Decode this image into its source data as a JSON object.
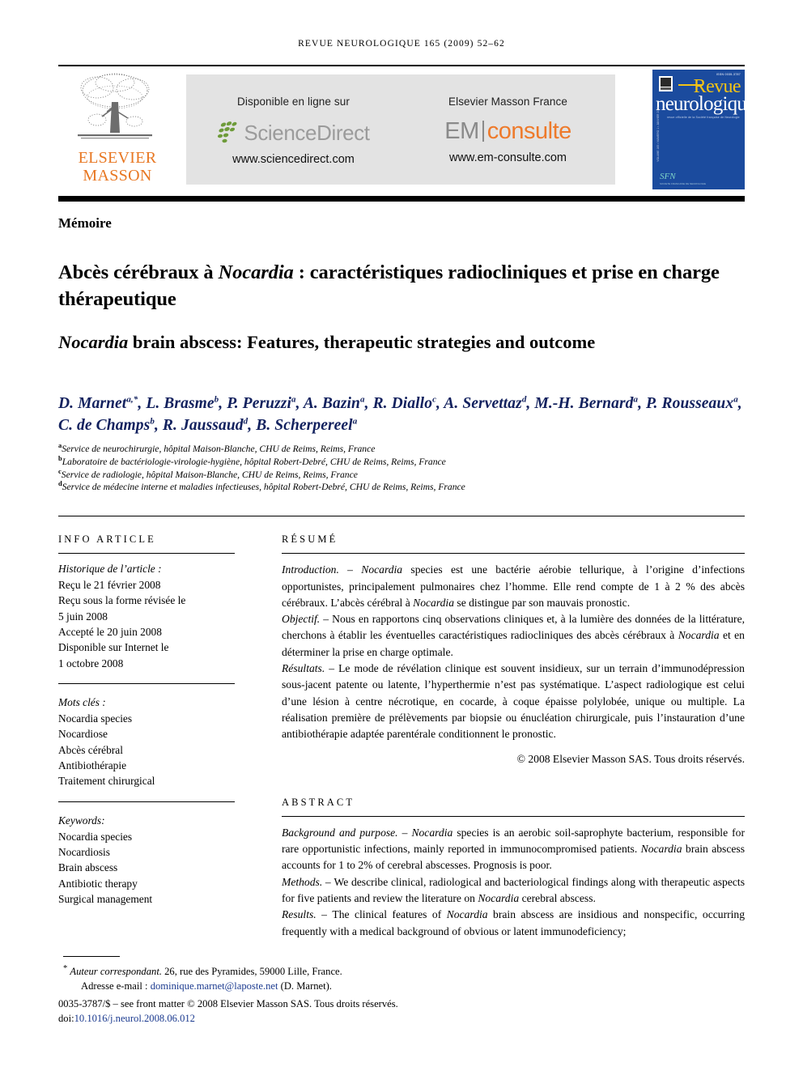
{
  "running_head": "REVUE NEUROLOGIQUE 165 (2009) 52–62",
  "banner": {
    "publisher_name_line1": "ELSEVIER",
    "publisher_name_line2": "MASSON",
    "sciencedirect": {
      "caption": "Disponible en ligne sur",
      "wordmark": "ScienceDirect",
      "url": "www.sciencedirect.com"
    },
    "emconsulte": {
      "caption": "Elsevier Masson France",
      "wordmark_em": "EM",
      "wordmark_consulte": "consulte",
      "url": "www.em-consulte.com"
    },
    "cover": {
      "title_line1": "Revue",
      "title_line2": "neurologique",
      "subline": "revue officielle de la Société française de Neurologie",
      "spine_text": "VOLUME 165 • NUMERO 1 • JANVIER 2009",
      "issn_tiny": "ISSN 0035-3787",
      "sfn_mark": "SFN",
      "sfn_sub": "SOCIETE FRANCAISE DE NEUROLOGIE"
    }
  },
  "article_type": "Mémoire",
  "title_fr": "Abcès cérébraux à Nocardia : caractéristiques radiocliniques et prise en charge thérapeutique",
  "title_fr_italic_word": "Nocardia",
  "title_en_pre": "",
  "title_en_italic_word": "Nocardia",
  "title_en_rest": " brain abscess: Features, therapeutic strategies and outcome",
  "authors": [
    {
      "name": "D. Marnet",
      "sup": "a,*"
    },
    {
      "name": "L. Brasme",
      "sup": "b"
    },
    {
      "name": "P. Peruzzi",
      "sup": "a"
    },
    {
      "name": "A. Bazin",
      "sup": "a"
    },
    {
      "name": "R. Diallo",
      "sup": "c"
    },
    {
      "name": "A. Servettaz",
      "sup": "d"
    },
    {
      "name": "M.-H. Bernard",
      "sup": "a"
    },
    {
      "name": "P. Rousseaux",
      "sup": "a"
    },
    {
      "name": "C. de Champs",
      "sup": "b"
    },
    {
      "name": "R. Jaussaud",
      "sup": "d"
    },
    {
      "name": "B. Scherpereel",
      "sup": "a"
    }
  ],
  "affiliations": [
    {
      "mark": "a",
      "text": "Service de neurochirurgie, hôpital Maison-Blanche, CHU de Reims, Reims, France"
    },
    {
      "mark": "b",
      "text": "Laboratoire de bactériologie-virologie-hygiène, hôpital Robert-Debré, CHU de Reims, Reims, France"
    },
    {
      "mark": "c",
      "text": "Service de radiologie, hôpital Maison-Blanche, CHU de Reims, Reims, France"
    },
    {
      "mark": "d",
      "text": "Service de médecine interne et maladies infectieuses, hôpital Robert-Debré, CHU de Reims, Reims, France"
    }
  ],
  "info_article": {
    "heading": "INFO ARTICLE",
    "history_label": "Historique de l’article :",
    "history_lines": [
      "Reçu le 21 février 2008",
      "Reçu sous la forme révisée le",
      "5 juin 2008",
      "Accepté le  20 juin 2008",
      "Disponible sur Internet le",
      "1 octobre 2008"
    ],
    "motscles_label": "Mots clés :",
    "motscles": [
      "Nocardia species",
      "Nocardiose",
      "Abcès cérébral",
      "Antibiothérapie",
      "Traitement chirurgical"
    ],
    "keywords_label": "Keywords:",
    "keywords": [
      "Nocardia species",
      "Nocardiosis",
      "Brain abscess",
      "Antibiotic therapy",
      "Surgical management"
    ]
  },
  "resume": {
    "heading": "RÉSUMÉ",
    "paragraphs": [
      {
        "lead": "Introduction. – ",
        "text_1": "Nocardia",
        "text_2": " species est une bactérie aérobie tellurique, à l’origine d’infections opportunistes, principalement pulmonaires chez l’homme. Elle rend compte de 1 à 2 % des abcès cérébraux. L’abcès cérébral à ",
        "text_3": "Nocardia",
        "text_4": " se distingue par son mauvais pronostic."
      },
      {
        "lead": "Objectif. – ",
        "text_1": "Nous en rapportons cinq observations cliniques et, à la lumière des données de la littérature, cherchons à établir les éventuelles caractéristiques radiocliniques des abcès cérébraux à ",
        "text_2": "Nocardia",
        "text_3": " et en déterminer la prise en charge optimale."
      },
      {
        "lead": "Résultats. – ",
        "text_1": "Le mode de révélation clinique est souvent insidieux, sur un terrain d’immunodépression sous-jacent patente ou latente, l’hyperthermie n’est pas systématique. L’aspect radiologique est celui d’une lésion à centre nécrotique, en cocarde, à coque épaisse polylobée, unique ou multiple. La réalisation première de prélèvements par biopsie ou énucléation chirurgicale, puis l’instauration d’une antibiothérapie adaptée parentérale conditionnent le pronostic."
      }
    ],
    "copyright": "© 2008 Elsevier Masson SAS. Tous droits réservés."
  },
  "abstract": {
    "heading": "ABSTRACT",
    "paragraphs": [
      {
        "lead": "Background and purpose. – ",
        "text_1": "Nocardia",
        "text_2": " species is an aerobic soil-saprophyte bacterium, responsible for rare opportunistic infections, mainly reported in immunocompromised patients. ",
        "text_3": "Nocardia",
        "text_4": " brain abscess accounts for 1 to 2% of cerebral abscesses. Prognosis is poor."
      },
      {
        "lead": "Methods. – ",
        "text_1": "We describe clinical, radiological and bacteriological findings along with therapeutic aspects for five patients and review the literature on ",
        "text_2": "Nocardia",
        "text_3": " cerebral abscess."
      },
      {
        "lead": "Results. – ",
        "text_1": "The clinical features of ",
        "text_2": "Nocardia",
        "text_3": " brain abscess are insidious and nonspecific, occurring frequently with a medical background of obvious or latent immunodeficiency;"
      }
    ]
  },
  "footer": {
    "corresponding_mark": "*",
    "corresponding_label": "Auteur correspondant.",
    "corresponding_address": " 26, rue des Pyramides, 59000 Lille, France.",
    "email_label": "Adresse e-mail : ",
    "email": "dominique.marnet@laposte.net",
    "email_attrib": " (D. Marnet).",
    "front_matter": "0035-3787/$ – see front matter © 2008 Elsevier Masson SAS. Tous droits réservés.",
    "doi_prefix": "doi:",
    "doi": "10.1016/j.neurol.2008.06.012"
  },
  "colors": {
    "author_blue": "#12215e",
    "link_blue": "#1b3a8f",
    "elsevier_orange": "#E87722",
    "emconsulte_orange": "#EE7A2B",
    "sciencedirect_gray": "#9b9b9b",
    "sciencedirect_green": "#6e9b3a",
    "cover_blue": "#1b4b9e",
    "cover_gold": "#f2c316",
    "panel_gray": "#e3e3e3"
  }
}
